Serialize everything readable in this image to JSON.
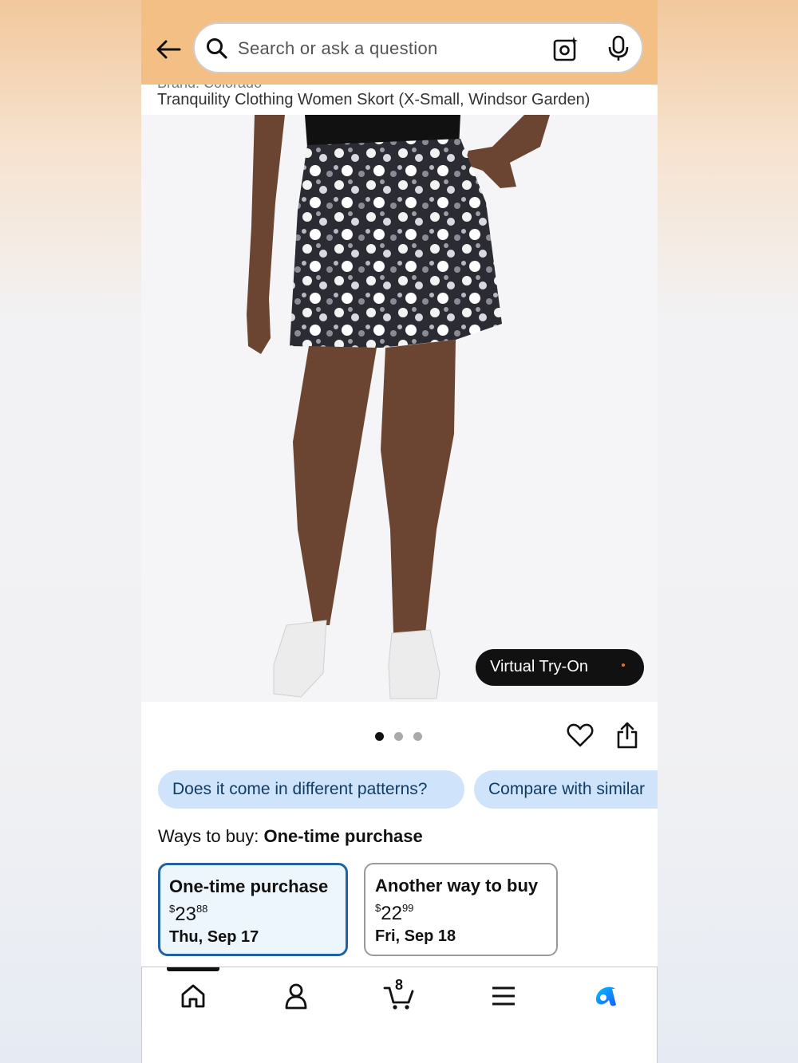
{
  "header": {
    "search_placeholder": "Search or ask a question",
    "icons": [
      "back-arrow-icon",
      "search-icon",
      "camera-icon",
      "mic-icon"
    ],
    "background_color": "#f4bf84"
  },
  "product": {
    "brand_partial": "Brand: Colorado",
    "title": "Tranquility Clothing Women Skort (X-Small, Windsor Garden)",
    "virtual_tryon_label": "Virtual Try-On",
    "image_count": 3,
    "active_image_index": 0
  },
  "chips": [
    {
      "label": "Does it come in different patterns?"
    },
    {
      "label": "Compare with similar"
    }
  ],
  "ways_to_buy": {
    "prefix": "Ways to buy:",
    "selected": "One-time purchase",
    "options": [
      {
        "title": "One-time purchase",
        "currency": "$",
        "dollars": "23",
        "cents": "88",
        "delivery": "Thu, Sep 17"
      },
      {
        "title": "Another way to buy",
        "currency": "$",
        "dollars": "22",
        "cents": "99",
        "delivery": "Fri, Sep 18"
      }
    ]
  },
  "bottom_nav": {
    "items": [
      "home-icon",
      "account-icon",
      "cart-icon",
      "menu-icon",
      "rufus-icon"
    ],
    "cart_count": "8",
    "accent_color": "#1e90ff"
  }
}
